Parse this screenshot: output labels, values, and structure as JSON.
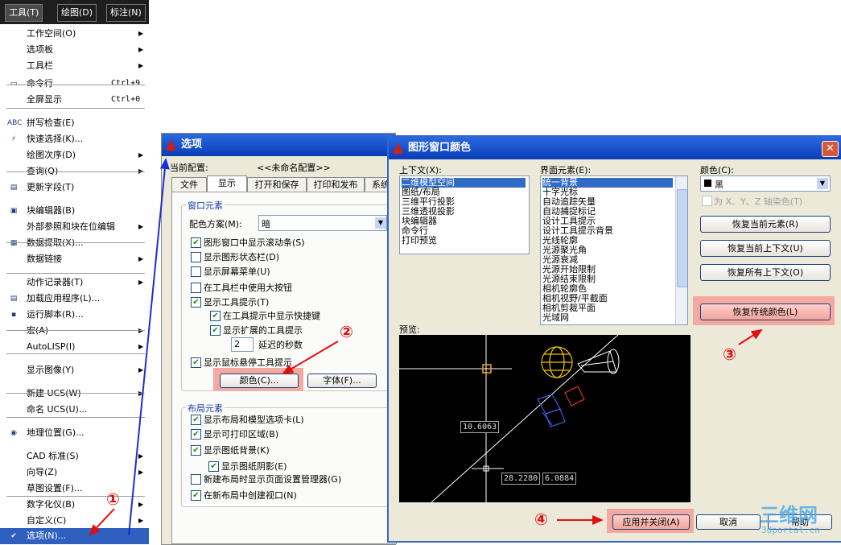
{
  "menubar": {
    "tools": "工具(T)",
    "draw": "绘图(D)",
    "dim": "标注(N)"
  },
  "menu": {
    "items": [
      {
        "label": "工作空间(O)",
        "shortcut": "",
        "sub": true
      },
      {
        "label": "选项板",
        "shortcut": "",
        "sub": true
      },
      {
        "label": "工具栏",
        "shortcut": "",
        "sub": true
      },
      {
        "label": "命令行",
        "shortcut": "Ctrl+9",
        "sub": false
      },
      {
        "label": "全屏显示",
        "shortcut": "Ctrl+0",
        "sub": false
      },
      {
        "label": "拼写检查(E)",
        "shortcut": "",
        "sub": false
      },
      {
        "label": "快速选择(K)...",
        "shortcut": "",
        "sub": false
      },
      {
        "label": "绘图次序(D)",
        "shortcut": "",
        "sub": true
      },
      {
        "label": "查询(Q)",
        "shortcut": "",
        "sub": true
      },
      {
        "label": "更新字段(T)",
        "shortcut": "",
        "sub": false
      },
      {
        "label": "块编辑器(B)",
        "shortcut": "",
        "sub": false
      },
      {
        "label": "外部参照和块在位编辑",
        "shortcut": "",
        "sub": true
      },
      {
        "label": "数据提取(X)...",
        "shortcut": "",
        "sub": false
      },
      {
        "label": "数据链接",
        "shortcut": "",
        "sub": true
      },
      {
        "label": "动作记录器(T)",
        "shortcut": "",
        "sub": true
      },
      {
        "label": "加载应用程序(L)...",
        "shortcut": "",
        "sub": false
      },
      {
        "label": "运行脚本(R)...",
        "shortcut": "",
        "sub": false
      },
      {
        "label": "宏(A)",
        "shortcut": "",
        "sub": true
      },
      {
        "label": "AutoLISP(I)",
        "shortcut": "",
        "sub": true
      },
      {
        "label": "显示图像(Y)",
        "shortcut": "",
        "sub": true
      },
      {
        "label": "新建 UCS(W)",
        "shortcut": "",
        "sub": true
      },
      {
        "label": "命名 UCS(U)...",
        "shortcut": "",
        "sub": false
      },
      {
        "label": "地理位置(G)...",
        "shortcut": "",
        "sub": false
      },
      {
        "label": "CAD 标准(S)",
        "shortcut": "",
        "sub": true
      },
      {
        "label": "向导(Z)",
        "shortcut": "",
        "sub": true
      },
      {
        "label": "草图设置(F)...",
        "shortcut": "",
        "sub": false
      },
      {
        "label": "数字化仪(B)",
        "shortcut": "",
        "sub": true
      },
      {
        "label": "自定义(C)",
        "shortcut": "",
        "sub": true
      },
      {
        "label": "选项(N)...",
        "shortcut": "",
        "sub": false
      }
    ]
  },
  "options": {
    "title": "选项",
    "profile_label": "当前配置:",
    "profile_value": "<<未命名配置>>",
    "tabs": [
      "文件",
      "显示",
      "打开和保存",
      "打印和发布",
      "系统"
    ],
    "window_group": "窗口元素",
    "color_scheme_label": "配色方案(M):",
    "color_scheme_value": "暗",
    "checks": [
      "图形窗口中显示滚动条(S)",
      "显示图形状态栏(D)",
      "显示屏幕菜单(U)",
      "在工具栏中使用大按钮",
      "显示工具提示(T)",
      "在工具提示中显示快捷键",
      "显示扩展的工具提示"
    ],
    "delay_value": "2",
    "delay_label": "延迟的秒数",
    "rollover_check": "显示鼠标悬停工具提示",
    "color_btn": "颜色(C)...",
    "font_btn": "字体(F)...",
    "layout_group": "布局元素",
    "layout_checks": [
      "显示布局和模型选项卡(L)",
      "显示可打印区域(B)",
      "显示图纸背景(K)",
      "显示图纸阴影(E)",
      "新建布局时显示页面设置管理器(G)",
      "在新布局中创建视口(N)"
    ]
  },
  "color_dialog": {
    "title": "图形窗口颜色",
    "context_label": "上下文(X):",
    "contexts": [
      "二维模型空间",
      "图纸/布局",
      "三维平行投影",
      "三维透视投影",
      "块编辑器",
      "命令行",
      "打印预览"
    ],
    "element_label": "界面元素(E):",
    "elements": [
      "统一背景",
      "十字光标",
      "自动追踪矢量",
      "自动捕捉标记",
      "设计工具提示",
      "设计工具提示背景",
      "光线轮廓",
      "光源聚光角",
      "光源衰减",
      "光源开始限制",
      "光源结束限制",
      "相机轮廓色",
      "相机视野/平截面",
      "相机剪裁平面",
      "光域网"
    ],
    "color_label": "颜色(C):",
    "color_value": "黑",
    "tint_label": "为 X、Y、Z 轴染色(T)",
    "restore_element": "恢复当前元素(R)",
    "restore_context": "恢复当前上下文(U)",
    "restore_all": "恢复所有上下文(O)",
    "restore_classic": "恢复传统颜色(L)",
    "preview_label": "预览:",
    "coord1": "10.6063",
    "coord2": "28.2280",
    "coord3": "6.0884",
    "apply_close": "应用并关闭(A)",
    "cancel": "取消",
    "help": "帮助"
  },
  "annotations": {
    "c1": "①",
    "c2": "②",
    "c3": "③",
    "c4": "④"
  },
  "watermark": {
    "main": "三维网",
    "sub": "3dportal.cn"
  },
  "colors": {
    "title_blue": "#0a3cb8",
    "highlight_red": "#f4a9a0",
    "arrow_red": "#e01010",
    "arrow_blue": "#1a2fd8"
  }
}
